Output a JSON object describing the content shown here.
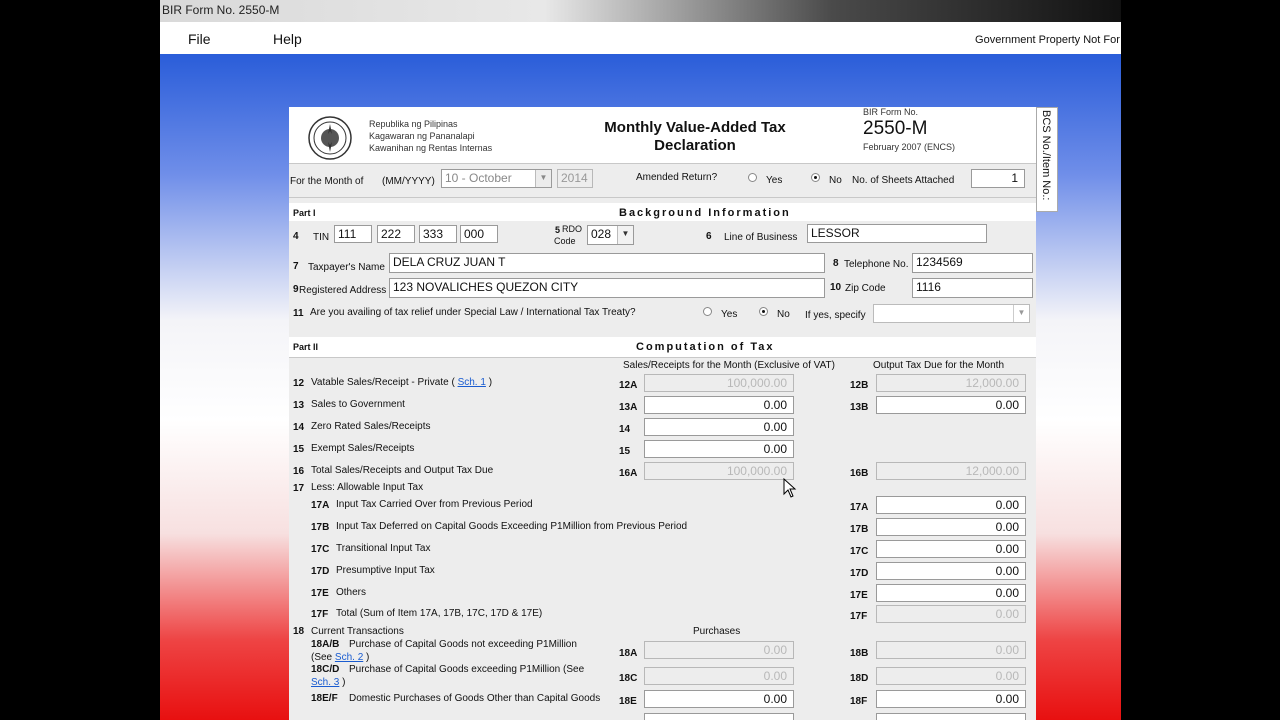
{
  "window": {
    "title": "BIR Form No. 2550-M"
  },
  "menu": {
    "file": "File",
    "help": "Help",
    "notice": "Government Property Not For Sale"
  },
  "header": {
    "agency_lines": [
      "Republika ng Pilipinas",
      "Kagawaran ng Pananalapi",
      "Kawanihan ng Rentas Internas"
    ],
    "title_line1": "Monthly Value-Added Tax",
    "title_line2": "Declaration",
    "form_no_label": "BIR Form No.",
    "form_no": "2550-M",
    "form_date": "February 2007 (ENCS)",
    "side_tab": "BCS No./Item No.:"
  },
  "period": {
    "label_prefix": "For the Month of",
    "label_format": "(MM/YYYY)",
    "month": "10 - October",
    "year": "2014",
    "amended_label": "Amended Return?",
    "yes": "Yes",
    "no": "No",
    "amended_selected": "No",
    "sheets_label": "No. of Sheets Attached",
    "sheets": "1"
  },
  "part1": {
    "part_label": "Part I",
    "title": "Background Information",
    "tin_no": "4",
    "tin_label": "TIN",
    "tin": [
      "111",
      "222",
      "333",
      "000"
    ],
    "rdo_no": "5",
    "rdo_label": "RDO",
    "rdo_label2": "Code",
    "rdo": "028",
    "lob_no": "6",
    "lob_label": "Line of Business",
    "lob": "LESSOR",
    "name_no": "7",
    "name_label": "Taxpayer's Name",
    "name": "DELA CRUZ JUAN T",
    "tel_no": "8",
    "tel_label": "Telephone No.",
    "tel": "1234569",
    "addr_no": "9",
    "addr_label": "Registered Address",
    "addr": "123 NOVALICHES QUEZON CITY",
    "zip_no": "10",
    "zip_label": "Zip Code",
    "zip": "1116",
    "relief_no": "11",
    "relief_label": "Are you availing of tax relief under Special Law / International Tax Treaty?",
    "relief_yes": "Yes",
    "relief_no_opt": "No",
    "relief_selected": "No",
    "specify_label": "If yes, specify",
    "specify": ""
  },
  "part2": {
    "part_label": "Part II",
    "title": "Computation of Tax",
    "col_sales": "Sales/Receipts for the Month (Exclusive of VAT)",
    "col_output": "Output Tax Due for the Month",
    "col_purchases": "Purchases",
    "rows": [
      {
        "no": "12",
        "label": "Vatable Sales/Receipt - Private (",
        "link": "Sch. 1",
        "after": ")",
        "code_a": "12A",
        "val_a": "100,000.00",
        "code_b": "12B",
        "val_b": "12,000.00"
      },
      {
        "no": "13",
        "label": "Sales to Government",
        "code_a": "13A",
        "val_a": "0.00",
        "code_b": "13B",
        "val_b": "0.00"
      },
      {
        "no": "14",
        "label": "Zero Rated Sales/Receipts",
        "code_a": "14",
        "val_a": "0.00"
      },
      {
        "no": "15",
        "label": "Exempt Sales/Receipts",
        "code_a": "15",
        "val_a": "0.00"
      },
      {
        "no": "16",
        "label": "Total Sales/Receipts and Output Tax Due",
        "code_a": "16A",
        "val_a": "100,000.00",
        "code_b": "16B",
        "val_b": "12,000.00"
      }
    ],
    "less": {
      "no": "17",
      "label": "Less: Allowable Input Tax"
    },
    "input_rows": [
      {
        "no": "17A",
        "label": "Input Tax Carried Over from Previous Period",
        "code": "17A",
        "val": "0.00"
      },
      {
        "no": "17B",
        "label": "Input Tax Deferred on Capital Goods Exceeding P1Million from Previous Period",
        "code": "17B",
        "val": "0.00"
      },
      {
        "no": "17C",
        "label": "Transitional Input Tax",
        "code": "17C",
        "val": "0.00"
      },
      {
        "no": "17D",
        "label": "Presumptive Input Tax",
        "code": "17D",
        "val": "0.00"
      },
      {
        "no": "17E",
        "label": "Others",
        "code": "17E",
        "val": "0.00"
      },
      {
        "no": "17F",
        "label": "Total (Sum of Item 17A, 17B, 17C, 17D & 17E)",
        "code": "17F",
        "val": "0.00"
      }
    ],
    "current": {
      "no": "18",
      "label": "Current Transactions"
    },
    "r18ab": {
      "no": "18A/B",
      "line1": "Purchase of Capital Goods not exceeding P1Million",
      "line2": "(See",
      "link": "Sch. 2",
      "after": ")",
      "code_a": "18A",
      "val_a": "0.00",
      "code_b": "18B",
      "val_b": "0.00"
    },
    "r18cd": {
      "no": "18C/D",
      "line1": "Purchase of Capital Goods exceeding P1Million (See",
      "link": "Sch. 3",
      "after": ")",
      "code_a": "18C",
      "val_a": "0.00",
      "code_b": "18D",
      "val_b": "0.00"
    },
    "r18ef": {
      "no": "18E/F",
      "label": "Domestic Purchases of Goods Other than Capital Goods",
      "code_a": "18E",
      "val_a": "0.00",
      "code_b": "18F",
      "val_b": "0.00"
    }
  }
}
